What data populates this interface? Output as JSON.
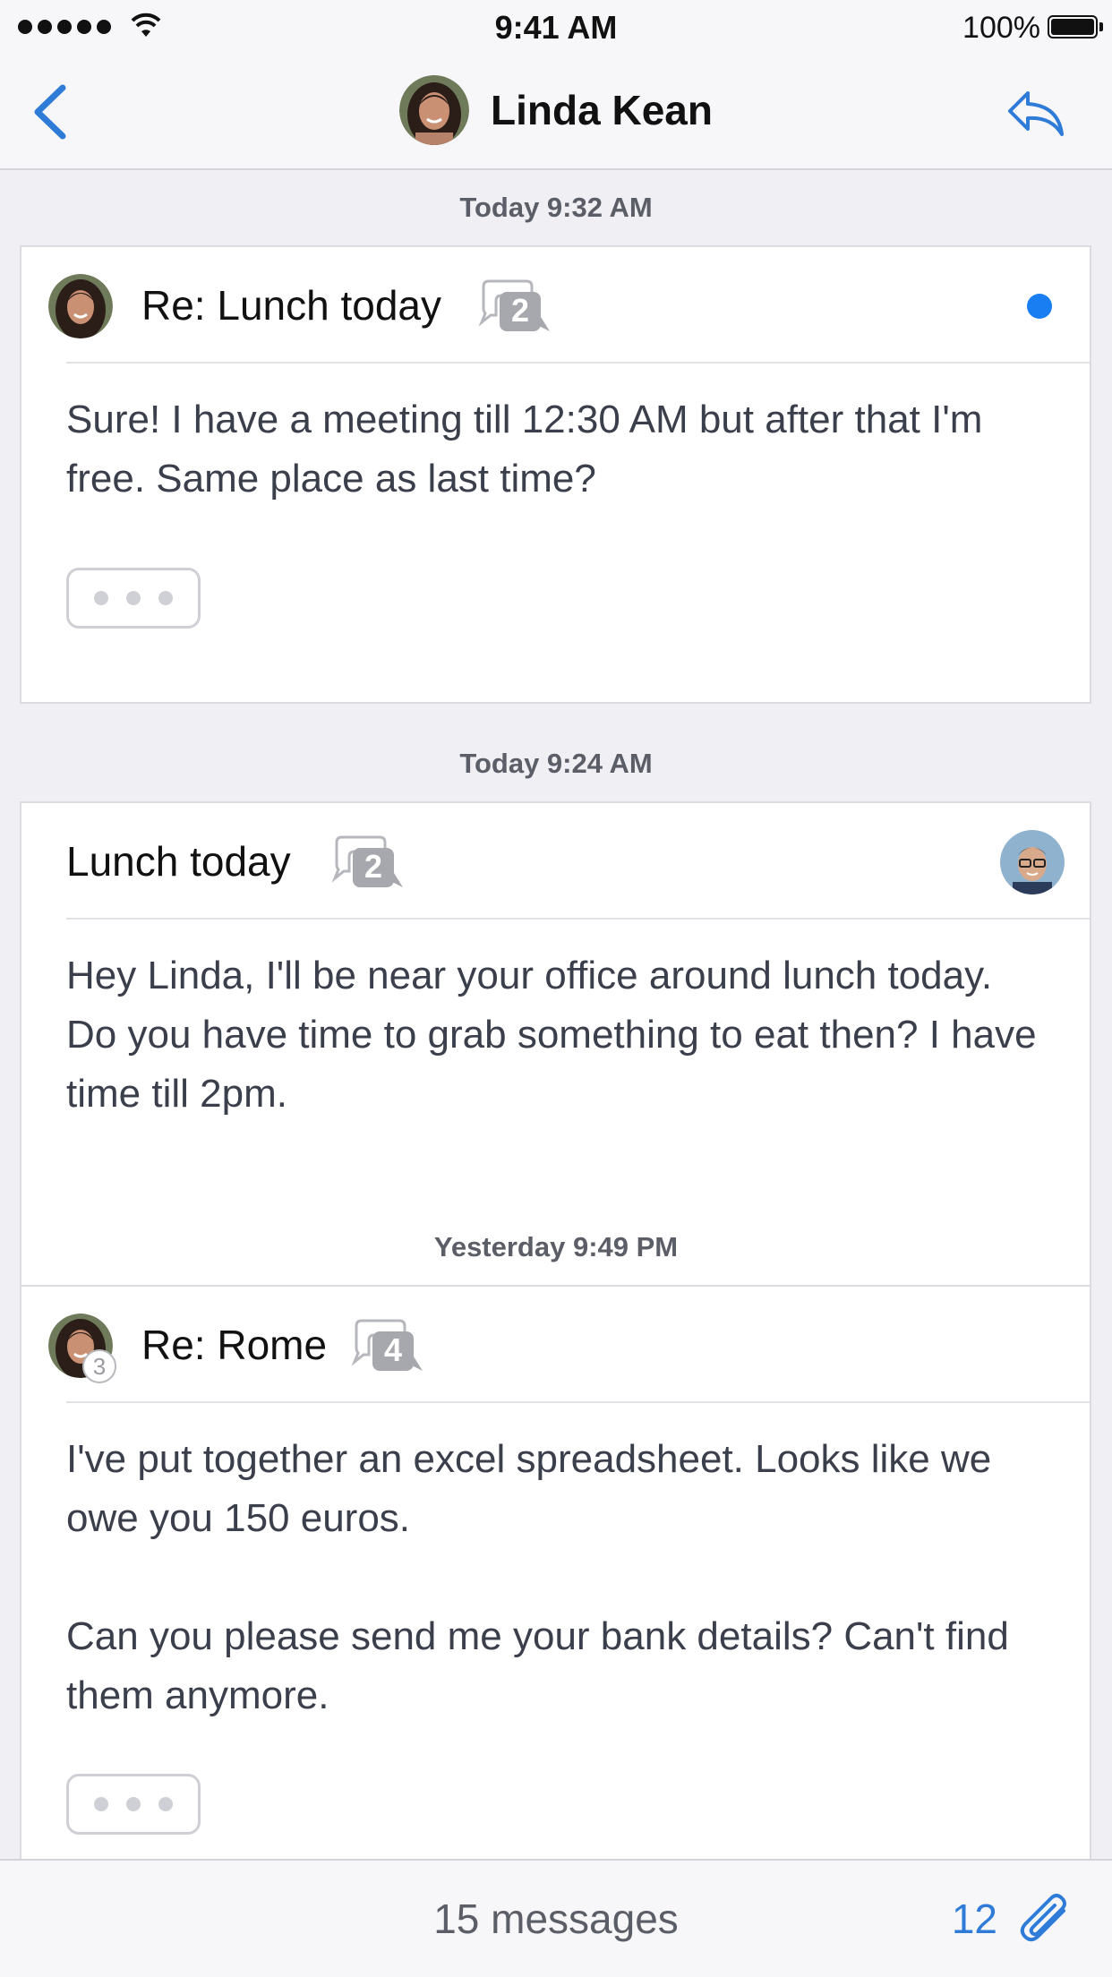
{
  "status_bar": {
    "time": "9:41 AM",
    "battery": "100%",
    "signal_icon": "signal-dots-icon",
    "wifi_icon": "wifi-icon",
    "battery_icon": "battery-icon"
  },
  "navbar": {
    "title": "Linda Kean",
    "back_icon": "chevron-left-icon",
    "reply_icon": "reply-icon",
    "accent_color": "#2f7bd8"
  },
  "messages": [
    {
      "timestamp": "Today 9:32 AM",
      "subject": "Re: Lunch today",
      "thread_count": "2",
      "unread": true,
      "body": [
        "Sure! I have a meeting till 12:30 AM but after that I'm free. Same place as last time?"
      ],
      "has_more": true
    },
    {
      "timestamp": "Today 9:24 AM",
      "subject": "Lunch today",
      "thread_count": "2",
      "unread": false,
      "body": [
        "Hey Linda, I'll be near your office around lunch today. Do you have time to grab something to eat then? I have time till 2pm."
      ],
      "has_more": false
    },
    {
      "timestamp": "Yesterday 9:49 PM",
      "subject": "Re: Rome",
      "thread_count": "4",
      "participant_count": "3",
      "unread": false,
      "body": [
        "I've put together an excel spreadsheet. Looks like we owe you 150 euros.",
        "Can you please send me your bank details? Can't find them anymore."
      ],
      "has_more": true
    }
  ],
  "bottom_bar": {
    "messages_count": "15 messages",
    "attachments_count": "12",
    "attach_icon": "paperclip-icon"
  },
  "colors": {
    "unread_dot": "#1a7ef3",
    "background": "#efeff4"
  }
}
